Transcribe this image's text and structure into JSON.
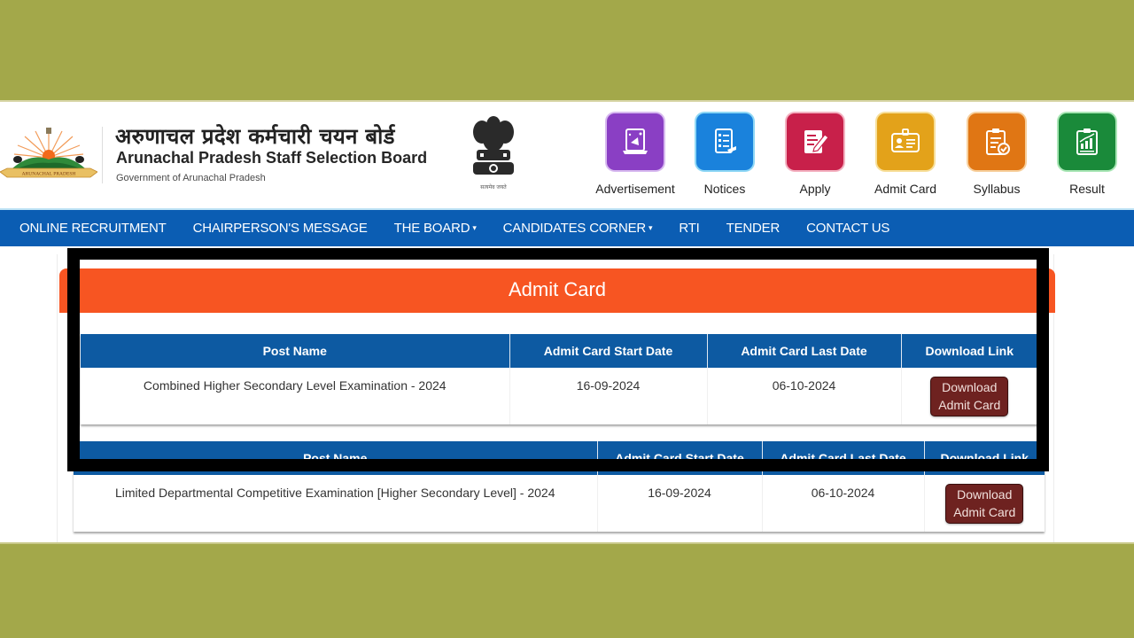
{
  "header": {
    "title_hindi": "अरुणाचल प्रदेश कर्मचारी चयन बोर्ड",
    "title_english": "Arunachal Pradesh Staff Selection Board",
    "subtitle": "Government of Arunachal Pradesh",
    "state_logo_banner": "ARUNACHAL PRADESH",
    "emblem_caption": "सत्यमेव जयते",
    "quick_links": [
      {
        "label": "Advertisement",
        "icon": "advertisement-icon",
        "color": "#8a3fc4"
      },
      {
        "label": "Notices",
        "icon": "notices-icon",
        "color": "#1a82dc"
      },
      {
        "label": "Apply",
        "icon": "apply-icon",
        "color": "#c8204a"
      },
      {
        "label": "Admit Card",
        "icon": "admit-card-icon",
        "color": "#e3a21a"
      },
      {
        "label": "Syllabus",
        "icon": "syllabus-icon",
        "color": "#e07614"
      },
      {
        "label": "Result",
        "icon": "result-icon",
        "color": "#1a8a3a"
      }
    ]
  },
  "nav": {
    "items": [
      {
        "label": "ONLINE RECRUITMENT",
        "dropdown": false
      },
      {
        "label": "CHAIRPERSON'S MESSAGE",
        "dropdown": false
      },
      {
        "label": "THE BOARD",
        "dropdown": true
      },
      {
        "label": "CANDIDATES CORNER",
        "dropdown": true
      },
      {
        "label": "RTI",
        "dropdown": false
      },
      {
        "label": "TENDER",
        "dropdown": false
      },
      {
        "label": "CONTACT US",
        "dropdown": false
      }
    ],
    "caret": "▾"
  },
  "main": {
    "section_title": "Admit Card",
    "columns": [
      "Post Name",
      "Admit Card Start Date",
      "Admit Card Last Date",
      "Download Link"
    ],
    "tables": [
      {
        "rows": [
          {
            "post_name": "Combined Higher Secondary Level Examination - 2024",
            "start_date": "16-09-2024",
            "last_date": "06-10-2024",
            "button_line1": "Download",
            "button_line2": "Admit Card"
          }
        ]
      },
      {
        "rows": [
          {
            "post_name": "Limited Departmental Competitive Examination [Higher Secondary Level] - 2024",
            "start_date": "16-09-2024",
            "last_date": "06-10-2024",
            "button_line1": "Download",
            "button_line2": "Admit Card"
          }
        ]
      }
    ]
  },
  "colors": {
    "background_band": "#a3a84a",
    "nav_blue": "#0b5db3",
    "table_header_blue": "#0d5aa2",
    "section_header_orange": "#f75522",
    "download_button": "#6e2220",
    "annotation_frame": "#000000"
  }
}
